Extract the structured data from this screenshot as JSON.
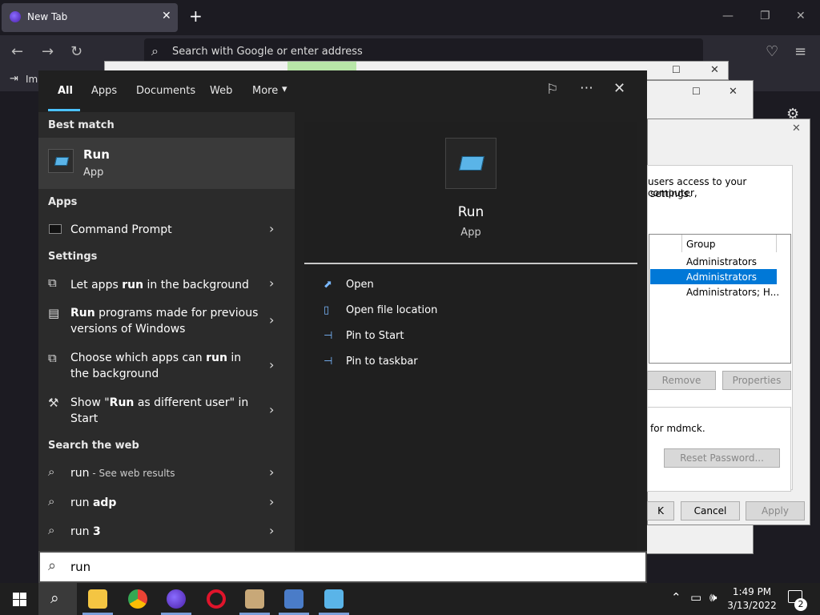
{
  "browser": {
    "tab_title": "New Tab",
    "tab_close": "✕",
    "new_tab": "+",
    "address_placeholder": "Search with Google or enter address",
    "bookmark_label": "Im"
  },
  "background": {
    "dialog_text1": "users access to your computer,",
    "dialog_text2": "settings.",
    "col_group": "Group",
    "rows": [
      "Administrators",
      "Administrators",
      "Administrators; H..."
    ],
    "remove": "Remove",
    "properties": "Properties",
    "for_user": "for mdmck.",
    "reset_password": "Reset Password...",
    "ok_partial": "K",
    "cancel": "Cancel",
    "apply": "Apply"
  },
  "start": {
    "filters": [
      "All",
      "Apps",
      "Documents",
      "Web",
      "More"
    ],
    "more_caret": "▾",
    "best_match_heading": "Best match",
    "best_match": {
      "title": "Run",
      "subtitle": "App"
    },
    "apps_heading": "Apps",
    "apps": [
      {
        "label": "Command Prompt"
      }
    ],
    "settings_heading": "Settings",
    "settings": [
      {
        "pre": "Let apps ",
        "bold": "run",
        "post": " in the background"
      },
      {
        "bold": "Run",
        "post": " programs made for previous",
        "line2": "versions of Windows"
      },
      {
        "pre": "Choose which apps can ",
        "bold": "run",
        "post": " in",
        "line2": "the background"
      },
      {
        "pre": "Show \"",
        "bold": "Run",
        "post": " as different user\" in",
        "line2": "Start"
      }
    ],
    "web_heading": "Search the web",
    "web": [
      {
        "main": "run",
        "sub": " - See web results"
      },
      {
        "main": "run ",
        "bold": "adp"
      },
      {
        "main": "run ",
        "bold": "3"
      }
    ],
    "detail": {
      "title": "Run",
      "subtitle": "App"
    },
    "actions": [
      "Open",
      "Open file location",
      "Pin to Start",
      "Pin to taskbar"
    ],
    "search_query": "run"
  },
  "taskbar": {
    "time": "1:49 PM",
    "date": "3/13/2022",
    "notification_count": "2"
  }
}
